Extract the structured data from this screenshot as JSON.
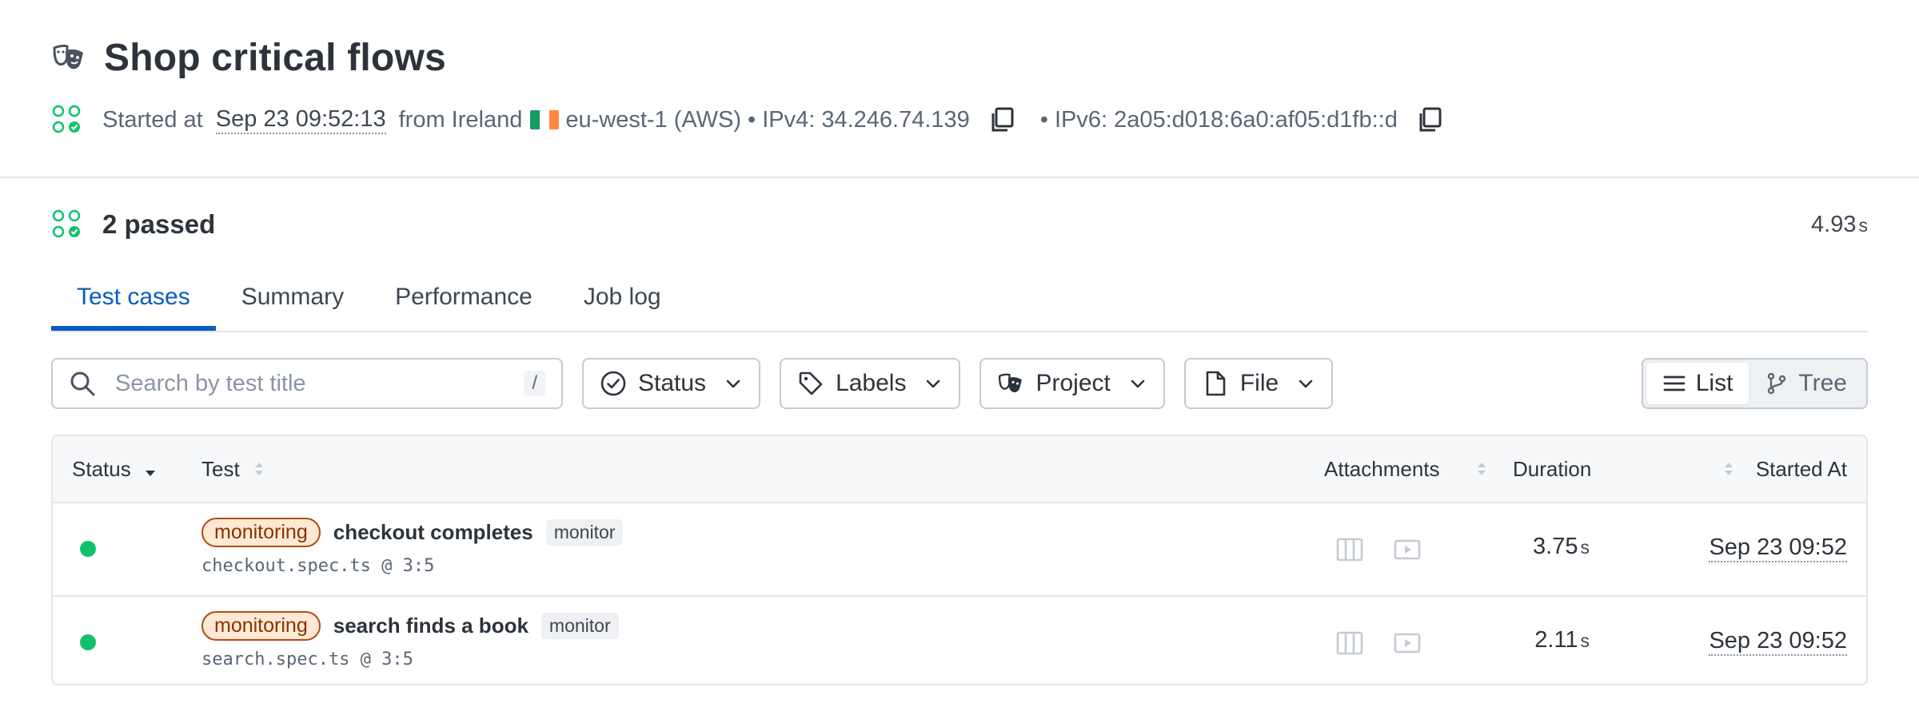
{
  "header": {
    "title": "Shop critical flows",
    "started_prefix": "Started at",
    "started_at": "Sep 23 09:52:13",
    "from_text": "from Ireland",
    "region": "eu-west-1 (AWS)",
    "separator": "•",
    "ipv4": "IPv4: 34.246.74.139",
    "ipv6": "IPv6: 2a05:d018:6a0:af05:d1fb::d",
    "flag_colors": [
      "#169b62",
      "#ffffff",
      "#ff883e"
    ]
  },
  "summary": {
    "passed": "2 passed",
    "duration_value": "4.93",
    "duration_unit": "s"
  },
  "tabs": [
    {
      "label": "Test cases",
      "active": true
    },
    {
      "label": "Summary",
      "active": false
    },
    {
      "label": "Performance",
      "active": false
    },
    {
      "label": "Job log",
      "active": false
    }
  ],
  "filters": {
    "search_placeholder": "Search by test title",
    "search_shortcut": "/",
    "status": "Status",
    "labels": "Labels",
    "project": "Project",
    "file": "File"
  },
  "view_toggle": {
    "list": "List",
    "tree": "Tree",
    "active": "list"
  },
  "table": {
    "columns": {
      "status": "Status",
      "test": "Test",
      "attachments": "Attachments",
      "duration": "Duration",
      "started_at": "Started At"
    },
    "rows": [
      {
        "status": "passed",
        "tag": "monitoring",
        "title": "checkout completes",
        "label": "monitor",
        "location": "checkout.spec.ts @ 3:5",
        "duration": "3.75",
        "duration_unit": "s",
        "started": "Sep 23 09:52"
      },
      {
        "status": "passed",
        "tag": "monitoring",
        "title": "search finds a book",
        "label": "monitor",
        "location": "search.spec.ts @ 3:5",
        "duration": "2.11",
        "duration_unit": "s",
        "started": "Sep 23 09:52"
      }
    ]
  },
  "colors": {
    "accent": "#0b5cc4",
    "passed": "#11c26d",
    "tag_bg": "#fde9d4",
    "tag_border": "#b44a12"
  },
  "icons": {
    "title": "theater-masks-icon",
    "status": "status-grid-icon",
    "copy": "copy-icon",
    "search": "search-icon",
    "status_filter": "check-circle-icon",
    "labels_filter": "tag-icon",
    "project_filter": "theater-masks-icon",
    "file_filter": "file-icon",
    "chevron": "chevron-down-icon",
    "list": "list-icon",
    "tree": "git-branch-icon",
    "trace": "columns-icon",
    "video": "video-icon"
  }
}
